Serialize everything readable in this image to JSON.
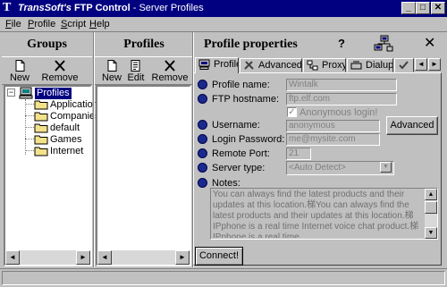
{
  "window": {
    "icon_glyph": "T",
    "title_brand": "TransSoft's",
    "title_app": "FTP Control",
    "title_rest": " - Server Profiles",
    "min_glyph": "_",
    "max_glyph": "□",
    "close_glyph": "✕"
  },
  "menu": [
    {
      "accel": "F",
      "rest": "ile"
    },
    {
      "accel": "P",
      "rest": "rofile"
    },
    {
      "accel": "S",
      "rest": "cript"
    },
    {
      "accel": "H",
      "rest": "elp"
    }
  ],
  "groups": {
    "title": "Groups",
    "toolbar": {
      "new": "New",
      "remove": "Remove"
    },
    "tree": {
      "root": "Profiles",
      "expander": "−",
      "children": [
        "Applications",
        "Companies",
        "default",
        "Games",
        "Internet"
      ]
    }
  },
  "profiles": {
    "title": "Profiles",
    "toolbar": {
      "new": "New",
      "edit": "Edit",
      "remove": "Remove"
    }
  },
  "properties": {
    "title": "Profile properties",
    "help_glyph": "?",
    "close_glyph": "✕",
    "tabs": [
      "Profile",
      "Advanced",
      "Proxy",
      "Dialup"
    ],
    "tab_scroll": {
      "left": "◄",
      "right": "►"
    },
    "form": {
      "profile_name_label": "Profile name:",
      "profile_name_value": "Wintalk",
      "ftp_hostname_label": "FTP hostname:",
      "ftp_hostname_value": "ftp.elf.com",
      "anonymous_label": "Anonymous login!",
      "anonymous_checked": true,
      "username_label": "Username:",
      "username_value": "anonymous",
      "advanced_button": "Advanced",
      "password_label": "Login Password:",
      "password_value": "me@mysite.com",
      "port_label": "Remote Port:",
      "port_value": "21",
      "server_type_label": "Server type:",
      "server_type_value": "<Auto Detect>",
      "notes_label": "Notes:",
      "notes_value": "You can always find the latest products and their updates at this location.梯You can always find the latest products and their updates at this location.梯IPphone is a real time Internet voice chat product.梯IPphone is a real time"
    },
    "connect_button": "Connect!"
  },
  "colors": {
    "title_bg": "#000080",
    "face": "#c0c0c0",
    "bullet": "#1a2a8c",
    "folder": "#f4e28a"
  }
}
